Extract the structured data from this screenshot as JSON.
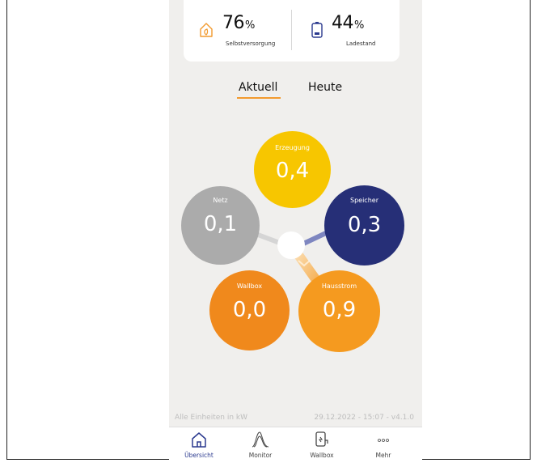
{
  "stats": {
    "self_supply": {
      "value": "76",
      "unit": "%",
      "label": "Selbstversorgung",
      "icon": "house-leaf-icon"
    },
    "charge_level": {
      "value": "44",
      "unit": "%",
      "label": "Ladestand",
      "icon": "battery-icon"
    }
  },
  "tabs": [
    {
      "label": "Aktuell",
      "active": true
    },
    {
      "label": "Heute",
      "active": false
    }
  ],
  "flow": {
    "erzeugung": {
      "label": "Erzeugung",
      "value": "0,4",
      "color": "#f7c600"
    },
    "netz": {
      "label": "Netz",
      "value": "0,1",
      "color": "#ababab"
    },
    "speicher": {
      "label": "Speicher",
      "value": "0,3",
      "color": "#262f77"
    },
    "wallbox": {
      "label": "Wallbox",
      "value": "0,0",
      "color": "#f0891c"
    },
    "hausstrom": {
      "label": "Hausstrom",
      "value": "0,9",
      "color": "#f59a1f"
    }
  },
  "footer": {
    "units_note": "Alle Einheiten in kW",
    "timestamp": "29.12.2022 - 15:07 - v4.1.0"
  },
  "nav": [
    {
      "label": "Übersicht",
      "icon": "home-icon",
      "active": true
    },
    {
      "label": "Monitor",
      "icon": "monitor-icon",
      "active": false
    },
    {
      "label": "Wallbox",
      "icon": "wallbox-icon",
      "active": false
    },
    {
      "label": "Mehr",
      "icon": "more-icon",
      "active": false
    }
  ],
  "colors": {
    "accent": "#f29a2e",
    "nav_active": "#2b3a8f"
  }
}
